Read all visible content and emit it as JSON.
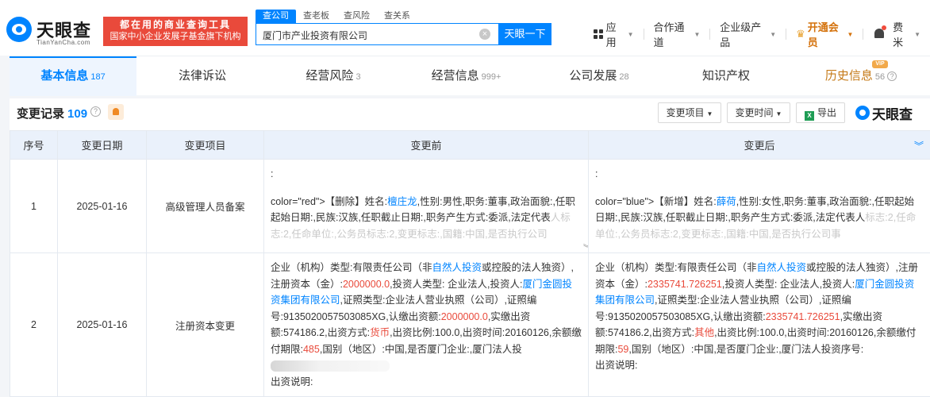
{
  "header": {
    "logo_text": "天眼查",
    "logo_sub": "TianYanCha.com",
    "slogan_line1": "都在用的商业查询工具",
    "slogan_line2": "国家中小企业发展子基金旗下机构",
    "search_tabs": [
      "查公司",
      "查老板",
      "查风险",
      "查关系"
    ],
    "search_value": "厦门市产业投资有限公司",
    "search_button": "天眼一下",
    "nav": {
      "apps": "应用",
      "partners": "合作通道",
      "enterprise": "企业级产品",
      "vip": "开通会员",
      "user": "费米"
    }
  },
  "tabs": [
    {
      "label": "基本信息",
      "count": "187"
    },
    {
      "label": "法律诉讼",
      "count": ""
    },
    {
      "label": "经营风险",
      "count": "3"
    },
    {
      "label": "经营信息",
      "count": "999+"
    },
    {
      "label": "公司发展",
      "count": "28"
    },
    {
      "label": "知识产权",
      "count": ""
    },
    {
      "label": "历史信息",
      "count": "56"
    }
  ],
  "vip_tag": "VIP",
  "section": {
    "title": "变更记录",
    "count": "109",
    "filter_item": "变更项目",
    "filter_time": "变更时间",
    "export": "导出",
    "brand": "天眼查"
  },
  "table": {
    "columns": [
      "序号",
      "变更日期",
      "变更项目",
      "变更前",
      "变更后"
    ],
    "rows": [
      {
        "index": "1",
        "date": "2025-01-16",
        "item": "高级管理人员备案",
        "before": {
          "colon": ":",
          "prefix": "color=\"red\">【删除】姓名:",
          "name": "檀庄龙",
          "mid": ",性别:男性,职务:董事,政治面貌:,任职起始日期:,民族:汉族,任职截止日期:,职务产生方式:委派,法定代表",
          "faded": "人标志:2,任命单位:,公务员标志:2,变更标志:,国籍:中国,是否执行公司"
        },
        "after": {
          "colon": ":",
          "prefix": "color=\"blue\">【新增】姓名:",
          "name": "薛荷",
          "mid": ",性别:女性,职务:董事,政治面貌:,任职起始日期:,民族:汉族,任职截止日期:,职务产生方式:委派,法定代表人",
          "faded": "标志:2,任命单位:,公务员标志:2,变更标志:,国籍:中国,是否执行公司事"
        }
      },
      {
        "index": "2",
        "date": "2025-01-16",
        "item": "注册资本变更",
        "before": {
          "t1": "企业（机构）类型:有限责任公司（非",
          "link1": "自然人投资",
          "t2": "或控股的法人独资）,注册资本（金）:",
          "capital": "2000000.0",
          "t3": ",投资人类型: 企业法人,投资人:",
          "investor": "厦门金圆投资集团有限公司",
          "t4": ",证照类型:企业法人营业执照（公司）,证照编号:9135020057503085XG,认缴出资额:",
          "capital2": "2000000.0",
          "t5": ",实缴出资额:574186.2,出资方式:",
          "method": "货币",
          "t6": ",出资比例:100.0,出资时间:20160126,余额缴付期限:",
          "term": "485",
          "t7": ",国别（地区）:中国,是否厦门企业:,厦门法人投",
          "t8": "出资说明:"
        },
        "after": {
          "t1": "企业（机构）类型:有限责任公司（非",
          "link1": "自然人投资",
          "t2": "或控股的法人独资）,注册资本（金）:",
          "capital": "2335741.726251",
          "t3": ",投资人类型: 企业法人,投资人:",
          "investor": "厦门金圆投资集团有限公司",
          "t4": ",证照类型:企业法人营业执照（公司）,证照编号:9135020057503085XG,认缴出资额:",
          "capital2": "2335741.726251",
          "t5": ",实缴出资额:574186.2,出资方式:",
          "method": "其他",
          "t6": ",出资比例:100.0,出资时间:20160126,余额缴付期限:",
          "term": "59",
          "t7": ",国别（地区）:中国,是否厦门企业:,厦门法人投资序号:",
          "t8": "出资说明:"
        }
      }
    ]
  },
  "colors": {
    "accent": "#0084ff",
    "red": "#e94a3b",
    "vip": "#d4720c"
  }
}
